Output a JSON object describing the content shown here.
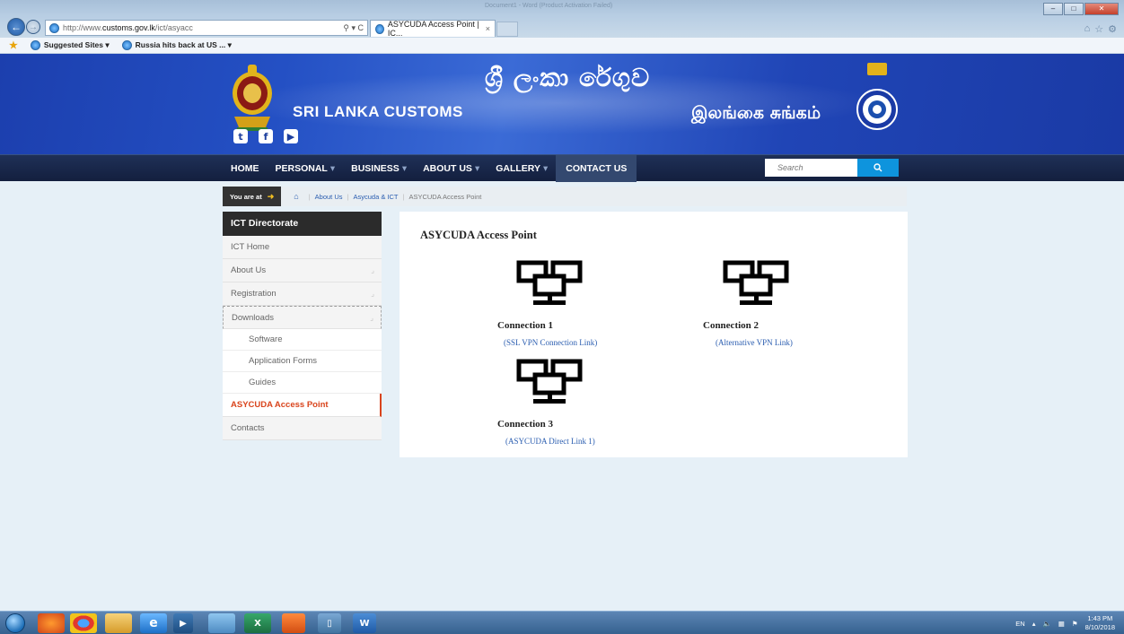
{
  "browser": {
    "window_title": "Document1 - Word (Product Activation Failed)",
    "url_prefix": "http://www.",
    "url_host": "customs.gov.lk",
    "url_path": "/ict/asyacc",
    "address_controls": "⚲ ▾ C",
    "tab_title": "ASYCUDA Access Point | IC...",
    "tab_close": "×",
    "favorites": [
      {
        "label": "Suggested Sites ▾"
      },
      {
        "label": "Russia hits back at US ... ▾"
      }
    ]
  },
  "header": {
    "sinhala_title": "ශ්‍රී ලංකා රේගුව",
    "site_title": "SRI LANKA CUSTOMS",
    "tamil_title": "இலங்கை சுங்கம்",
    "socials": [
      {
        "icon": "twitter-icon",
        "glyph": "t"
      },
      {
        "icon": "facebook-icon",
        "glyph": "f"
      },
      {
        "icon": "youtube-icon",
        "glyph": "▶"
      }
    ],
    "brand_color": "#2450c4"
  },
  "navbar": {
    "items": [
      {
        "label": "HOME",
        "caret": ""
      },
      {
        "label": "PERSONAL",
        "caret": "▾"
      },
      {
        "label": "BUSINESS",
        "caret": "▾"
      },
      {
        "label": "ABOUT US",
        "caret": "▾"
      },
      {
        "label": "GALLERY",
        "caret": "▾"
      },
      {
        "label": "CONTACT US",
        "caret": "",
        "active": true
      }
    ],
    "search_placeholder": "Search",
    "search_icon": "search-icon"
  },
  "breadcrumb": {
    "prefix": "You are at",
    "items": [
      "About Us",
      "Asycuda & ICT",
      "ASYCUDA Access Point"
    ]
  },
  "sidebar": {
    "heading": "ICT Directorate",
    "items": [
      {
        "label": "ICT Home",
        "expandable": false
      },
      {
        "label": "About Us",
        "expandable": true
      },
      {
        "label": "Registration",
        "expandable": true
      },
      {
        "label": "Downloads",
        "expandable": true,
        "open": true
      }
    ],
    "subitems": [
      "Software",
      "Application Forms",
      "Guides"
    ],
    "current": "ASYCUDA Access Point",
    "last": "Contacts",
    "accent_color": "#d9441c"
  },
  "main": {
    "title": "ASYCUDA Access Point",
    "connections": [
      {
        "title": "Connection 1",
        "link": "(SSL VPN Connection Link)"
      },
      {
        "title": "Connection 2",
        "link": "(Alternative VPN Link)"
      },
      {
        "title": "Connection 3",
        "link": "(ASYCUDA Direct Link 1)"
      }
    ],
    "link_color": "#2a5db0"
  },
  "taskbar": {
    "language": "EN",
    "time": "1:43 PM",
    "date": "8/10/2018",
    "apps": [
      "firefox-icon",
      "chrome-icon",
      "explorer-icon",
      "ie-icon",
      "media-icon",
      "files-icon",
      "excel-icon",
      "app-icon",
      "window-icon",
      "word-icon"
    ]
  }
}
